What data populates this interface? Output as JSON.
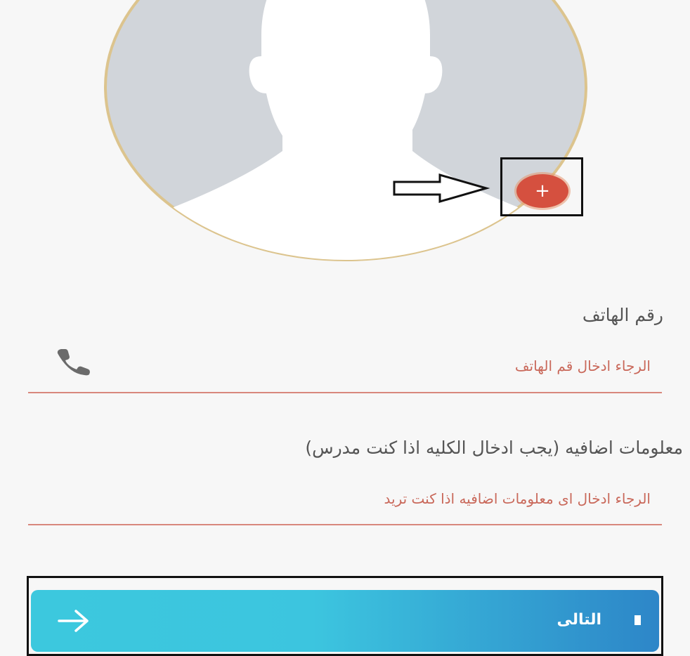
{
  "avatar": {
    "icon": "person-silhouette-icon",
    "add_button_icon": "plus-icon",
    "add_button_symbol": "+",
    "add_button_color": "#d5503f"
  },
  "phone": {
    "label": "رقم الهاتف",
    "placeholder": "الرجاء ادخال قم الهاتف",
    "icon": "phone-icon"
  },
  "extra_info": {
    "label": "معلومات اضافيه (يجب ادخال الكليه اذا كنت مدرس)",
    "placeholder": "الرجاء ادخال اى معلومات اضافيه اذا كنت تريد"
  },
  "next_button": {
    "label": "التالى",
    "icon": "arrow-right-icon"
  },
  "colors": {
    "accent_red": "#d5503f",
    "underline": "#d8877d",
    "button_gradient_start": "#3cc8de",
    "button_gradient_end": "#2d86c8"
  }
}
